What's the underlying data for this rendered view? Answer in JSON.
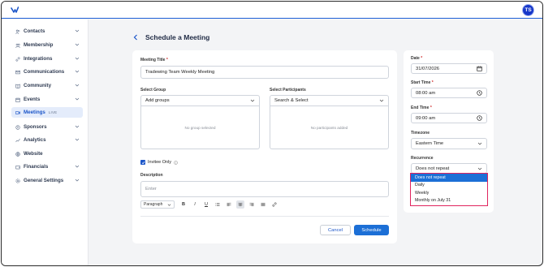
{
  "header": {
    "avatar_initials": "TS"
  },
  "sidebar": {
    "items": [
      {
        "label": "Contacts",
        "icon": "contacts-icon"
      },
      {
        "label": "Membership",
        "icon": "membership-icon"
      },
      {
        "label": "Integrations",
        "icon": "link-icon"
      },
      {
        "label": "Communications",
        "icon": "mail-icon"
      },
      {
        "label": "Community",
        "icon": "book-icon"
      },
      {
        "label": "Events",
        "icon": "calendar-icon"
      },
      {
        "label": "Meetings",
        "icon": "video-icon",
        "badge": "LIVE",
        "active": true
      },
      {
        "label": "Sponsors",
        "icon": "sponsor-icon"
      },
      {
        "label": "Analytics",
        "icon": "analytics-icon"
      },
      {
        "label": "Website",
        "icon": "globe-icon"
      },
      {
        "label": "Financials",
        "icon": "wallet-icon"
      },
      {
        "label": "General Settings",
        "icon": "gear-icon"
      }
    ]
  },
  "page": {
    "title": "Schedule a Meeting"
  },
  "form": {
    "meeting_title_label": "Meeting Title",
    "meeting_title_value": "Tradewing Team Weekly Meeting",
    "required_mark": "*",
    "select_group_label": "Select Group",
    "select_group_placeholder": "Add groups",
    "no_group_text": "No group selected",
    "select_participants_label": "Select Participants",
    "select_participants_placeholder": "Search & Select",
    "no_participants_text": "No participants added",
    "invitee_only_label": "Invitee Only",
    "invitee_only_checked": true,
    "description_label": "Description",
    "description_placeholder": "Enter",
    "editor": {
      "paragraph_label": "Paragraph",
      "bold": "B",
      "italic": "I",
      "underline": "U"
    },
    "cancel_label": "Cancel",
    "save_label": "Schedule"
  },
  "side": {
    "date_label": "Date",
    "date_value": "31/07/2026",
    "start_label": "Start Time",
    "start_value": "08:00 am",
    "end_label": "End Time",
    "end_value": "09:00 am",
    "timezone_label": "Timezone",
    "timezone_value": "Eastern Time",
    "recurrence_label": "Recurrence",
    "recurrence_value": "Does not repeat",
    "recurrence_options": [
      "Does not repeat",
      "Daily",
      "Weekly",
      "Monthly on July 31"
    ]
  },
  "colors": {
    "accent": "#1c6fd6",
    "highlight_border": "#e0245e",
    "avatar_bg": "#1637c9"
  }
}
